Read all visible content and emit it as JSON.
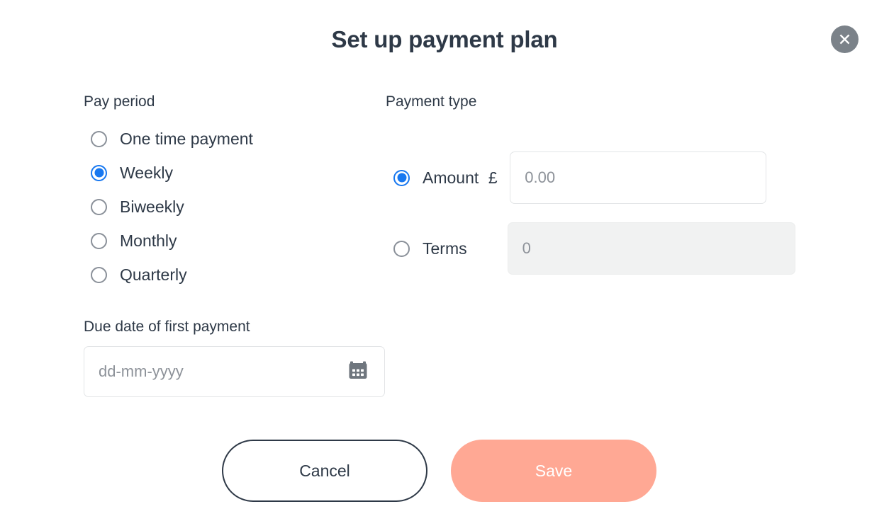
{
  "modal": {
    "title": "Set up payment plan",
    "close_icon": "close-circle-icon"
  },
  "pay_period": {
    "heading": "Pay period",
    "selected": "Weekly",
    "options": [
      {
        "label": "One time payment",
        "checked": false
      },
      {
        "label": "Weekly",
        "checked": true
      },
      {
        "label": "Biweekly",
        "checked": false
      },
      {
        "label": "Monthly",
        "checked": false
      },
      {
        "label": "Quarterly",
        "checked": false
      }
    ]
  },
  "payment_type": {
    "heading": "Payment type",
    "selected": "Amount",
    "amount": {
      "label": "Amount",
      "checked": true,
      "currency_symbol": "£",
      "value": "",
      "placeholder": "0.00",
      "disabled": false
    },
    "terms": {
      "label": "Terms",
      "checked": false,
      "value": "",
      "placeholder": "0",
      "disabled": true
    }
  },
  "due_date": {
    "label": "Due date of first payment",
    "value": "",
    "placeholder": "dd-mm-yyyy",
    "icon": "calendar-icon"
  },
  "footer": {
    "cancel_label": "Cancel",
    "save_label": "Save"
  },
  "colors": {
    "accent_blue": "#1878f0",
    "save_salmon": "#ffa894",
    "text_dark": "#2e3947",
    "close_gray": "#7b8289",
    "placeholder_gray": "#8d9299",
    "disabled_bg": "#f1f2f2",
    "border_gray": "#e3e5e7"
  }
}
